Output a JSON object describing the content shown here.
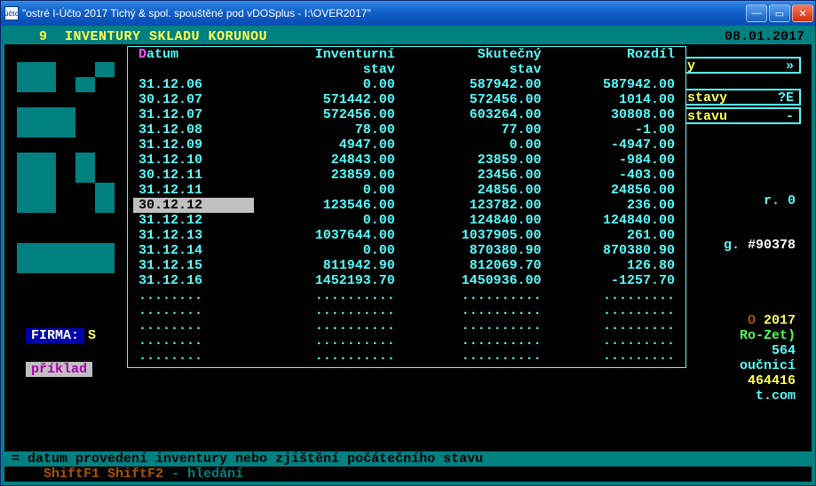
{
  "window": {
    "title": "\"ostré I-Účto 2017 Tichý & spol. spouštěné pod vDOSplus - I:\\OVER2017\"",
    "icon_text": "účto"
  },
  "header": {
    "number": "9",
    "title": "INVENTURY SKLADU KORUNOU",
    "date": "08.01.2017"
  },
  "popup": {
    "columns": {
      "c1_hot": "D",
      "c1_rest": "atum",
      "c2a": "Inventurní",
      "c2b": "stav",
      "c3a": "Skutečný",
      "c3b": "stav",
      "c4": "Rozdíl"
    },
    "selected_index": 9,
    "rows": [
      {
        "d": "31.12.06",
        "inv": "0.00",
        "sk": "587942.00",
        "r": "587942.00"
      },
      {
        "d": "30.12.07",
        "inv": "571442.00",
        "sk": "572456.00",
        "r": "1014.00"
      },
      {
        "d": "31.12.07",
        "inv": "572456.00",
        "sk": "603264.00",
        "r": "30808.00"
      },
      {
        "d": "31.12.08",
        "inv": "78.00",
        "sk": "77.00",
        "r": "-1.00"
      },
      {
        "d": "31.12.09",
        "inv": "4947.00",
        "sk": "0.00",
        "r": "-4947.00"
      },
      {
        "d": "31.12.10",
        "inv": "24843.00",
        "sk": "23859.00",
        "r": "-984.00"
      },
      {
        "d": "30.12.11",
        "inv": "23859.00",
        "sk": "23456.00",
        "r": "-403.00"
      },
      {
        "d": "31.12.11",
        "inv": "0.00",
        "sk": "24856.00",
        "r": "24856.00"
      },
      {
        "d": "30.12.12",
        "inv": "123546.00",
        "sk": "123782.00",
        "r": "236.00"
      },
      {
        "d": "31.12.12",
        "inv": "0.00",
        "sk": "124840.00",
        "r": "124840.00"
      },
      {
        "d": "31.12.13",
        "inv": "1037644.00",
        "sk": "1037905.00",
        "r": "261.00"
      },
      {
        "d": "31.12.14",
        "inv": "0.00",
        "sk": "870380.90",
        "r": "870380.90"
      },
      {
        "d": "31.12.15",
        "inv": "811942.90",
        "sk": "812069.70",
        "r": "126.80"
      },
      {
        "d": "31.12.16",
        "inv": "1452193.70",
        "sk": "1450936.00",
        "r": "-1257.70"
      }
    ],
    "empty_rows": 5,
    "dots": {
      "d": "........",
      "inv": "..........",
      "sk": "..........",
      "r": "........."
    }
  },
  "left": {
    "firma_label": "FIRMA:",
    "firma_value": "S",
    "priklad": "příklad"
  },
  "right_menu": {
    "items": [
      {
        "label": "y",
        "suffix": "»"
      },
      {
        "label": "stavy",
        "suffix": "?E"
      },
      {
        "label": "stavu",
        "suffix": "-"
      }
    ]
  },
  "right_info": {
    "l1": "r. 0",
    "l2a": "g. ",
    "l2b": "#90378",
    "l3a": "O ",
    "l3b": "2017",
    "l4": "Ro-Zet)",
    "l5": "564",
    "l6": "oučnicí",
    "l7": "464416",
    "l8": "t.com"
  },
  "footer": {
    "line1": "= datum provedení inventury nebo zjištění počátečního stavu",
    "line2_keys": "    ShiftF1 ShiftF2",
    "line2_rest": " - hledání"
  }
}
